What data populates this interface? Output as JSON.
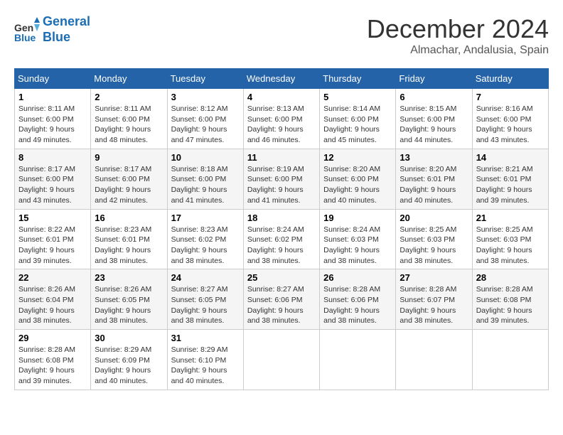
{
  "header": {
    "logo_line1": "General",
    "logo_line2": "Blue",
    "month_year": "December 2024",
    "location": "Almachar, Andalusia, Spain"
  },
  "calendar": {
    "days_of_week": [
      "Sunday",
      "Monday",
      "Tuesday",
      "Wednesday",
      "Thursday",
      "Friday",
      "Saturday"
    ],
    "weeks": [
      [
        null,
        null,
        null,
        null,
        null,
        null,
        null
      ],
      [
        null,
        null,
        null,
        null,
        null,
        null,
        null
      ],
      [
        null,
        null,
        null,
        null,
        null,
        null,
        null
      ],
      [
        null,
        null,
        null,
        null,
        null,
        null,
        null
      ],
      [
        null,
        null,
        null,
        null,
        null,
        null,
        null
      ]
    ],
    "cells": [
      [
        {
          "day": "1",
          "sunrise": "8:11 AM",
          "sunset": "6:00 PM",
          "daylight": "9 hours and 49 minutes."
        },
        {
          "day": "2",
          "sunrise": "8:11 AM",
          "sunset": "6:00 PM",
          "daylight": "9 hours and 48 minutes."
        },
        {
          "day": "3",
          "sunrise": "8:12 AM",
          "sunset": "6:00 PM",
          "daylight": "9 hours and 47 minutes."
        },
        {
          "day": "4",
          "sunrise": "8:13 AM",
          "sunset": "6:00 PM",
          "daylight": "9 hours and 46 minutes."
        },
        {
          "day": "5",
          "sunrise": "8:14 AM",
          "sunset": "6:00 PM",
          "daylight": "9 hours and 45 minutes."
        },
        {
          "day": "6",
          "sunrise": "8:15 AM",
          "sunset": "6:00 PM",
          "daylight": "9 hours and 44 minutes."
        },
        {
          "day": "7",
          "sunrise": "8:16 AM",
          "sunset": "6:00 PM",
          "daylight": "9 hours and 43 minutes."
        }
      ],
      [
        {
          "day": "8",
          "sunrise": "8:17 AM",
          "sunset": "6:00 PM",
          "daylight": "9 hours and 43 minutes."
        },
        {
          "day": "9",
          "sunrise": "8:17 AM",
          "sunset": "6:00 PM",
          "daylight": "9 hours and 42 minutes."
        },
        {
          "day": "10",
          "sunrise": "8:18 AM",
          "sunset": "6:00 PM",
          "daylight": "9 hours and 41 minutes."
        },
        {
          "day": "11",
          "sunrise": "8:19 AM",
          "sunset": "6:00 PM",
          "daylight": "9 hours and 41 minutes."
        },
        {
          "day": "12",
          "sunrise": "8:20 AM",
          "sunset": "6:00 PM",
          "daylight": "9 hours and 40 minutes."
        },
        {
          "day": "13",
          "sunrise": "8:20 AM",
          "sunset": "6:01 PM",
          "daylight": "9 hours and 40 minutes."
        },
        {
          "day": "14",
          "sunrise": "8:21 AM",
          "sunset": "6:01 PM",
          "daylight": "9 hours and 39 minutes."
        }
      ],
      [
        {
          "day": "15",
          "sunrise": "8:22 AM",
          "sunset": "6:01 PM",
          "daylight": "9 hours and 39 minutes."
        },
        {
          "day": "16",
          "sunrise": "8:23 AM",
          "sunset": "6:01 PM",
          "daylight": "9 hours and 38 minutes."
        },
        {
          "day": "17",
          "sunrise": "8:23 AM",
          "sunset": "6:02 PM",
          "daylight": "9 hours and 38 minutes."
        },
        {
          "day": "18",
          "sunrise": "8:24 AM",
          "sunset": "6:02 PM",
          "daylight": "9 hours and 38 minutes."
        },
        {
          "day": "19",
          "sunrise": "8:24 AM",
          "sunset": "6:03 PM",
          "daylight": "9 hours and 38 minutes."
        },
        {
          "day": "20",
          "sunrise": "8:25 AM",
          "sunset": "6:03 PM",
          "daylight": "9 hours and 38 minutes."
        },
        {
          "day": "21",
          "sunrise": "8:25 AM",
          "sunset": "6:03 PM",
          "daylight": "9 hours and 38 minutes."
        }
      ],
      [
        {
          "day": "22",
          "sunrise": "8:26 AM",
          "sunset": "6:04 PM",
          "daylight": "9 hours and 38 minutes."
        },
        {
          "day": "23",
          "sunrise": "8:26 AM",
          "sunset": "6:05 PM",
          "daylight": "9 hours and 38 minutes."
        },
        {
          "day": "24",
          "sunrise": "8:27 AM",
          "sunset": "6:05 PM",
          "daylight": "9 hours and 38 minutes."
        },
        {
          "day": "25",
          "sunrise": "8:27 AM",
          "sunset": "6:06 PM",
          "daylight": "9 hours and 38 minutes."
        },
        {
          "day": "26",
          "sunrise": "8:28 AM",
          "sunset": "6:06 PM",
          "daylight": "9 hours and 38 minutes."
        },
        {
          "day": "27",
          "sunrise": "8:28 AM",
          "sunset": "6:07 PM",
          "daylight": "9 hours and 38 minutes."
        },
        {
          "day": "28",
          "sunrise": "8:28 AM",
          "sunset": "6:08 PM",
          "daylight": "9 hours and 39 minutes."
        }
      ],
      [
        {
          "day": "29",
          "sunrise": "8:28 AM",
          "sunset": "6:08 PM",
          "daylight": "9 hours and 39 minutes."
        },
        {
          "day": "30",
          "sunrise": "8:29 AM",
          "sunset": "6:09 PM",
          "daylight": "9 hours and 40 minutes."
        },
        {
          "day": "31",
          "sunrise": "8:29 AM",
          "sunset": "6:10 PM",
          "daylight": "9 hours and 40 minutes."
        },
        null,
        null,
        null,
        null
      ]
    ]
  }
}
